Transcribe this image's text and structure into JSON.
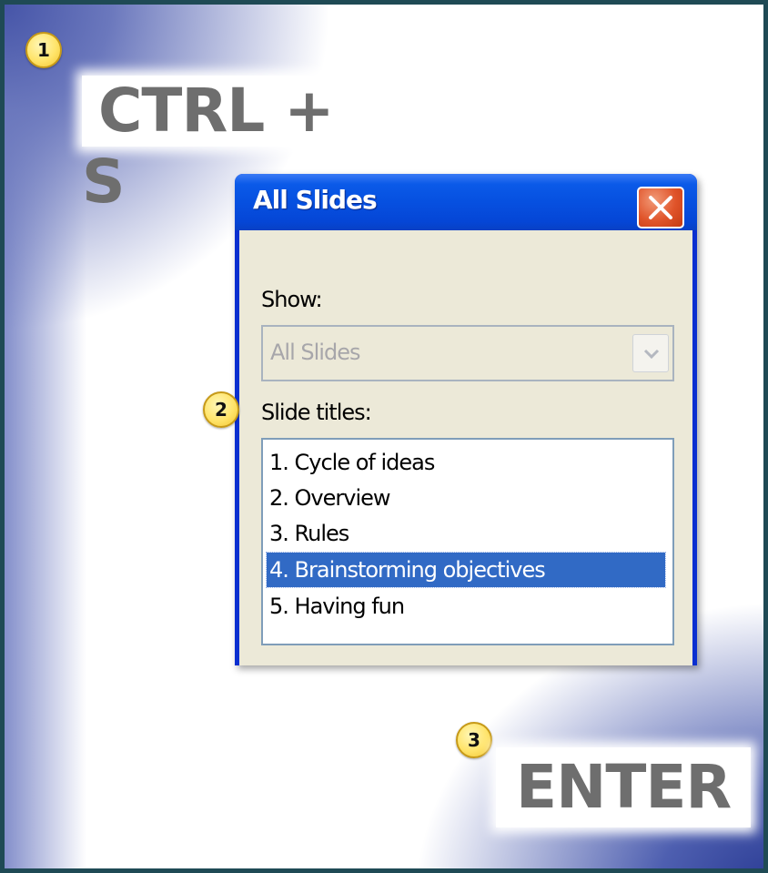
{
  "steps": [
    {
      "number": "1",
      "key": "CTRL + S"
    },
    {
      "number": "2"
    },
    {
      "number": "3",
      "key": "ENTER"
    }
  ],
  "dialog": {
    "title": "All Slides",
    "show_label": "Show:",
    "show_value": "All Slides",
    "titles_label": "Slide titles:",
    "items": [
      {
        "label": "1. Cycle of ideas",
        "selected": false
      },
      {
        "label": "2. Overview",
        "selected": false
      },
      {
        "label": "3. Rules",
        "selected": false
      },
      {
        "label": "4. Brainstorming objectives",
        "selected": true
      },
      {
        "label": "5. Having fun",
        "selected": false
      }
    ],
    "close_icon": "close-icon",
    "dropdown_icon": "chevron-down-icon"
  },
  "colors": {
    "titlebar": "#0650e0",
    "selection": "#316ac5",
    "badge": "#ffe46a",
    "close_button": "#e0542a"
  }
}
